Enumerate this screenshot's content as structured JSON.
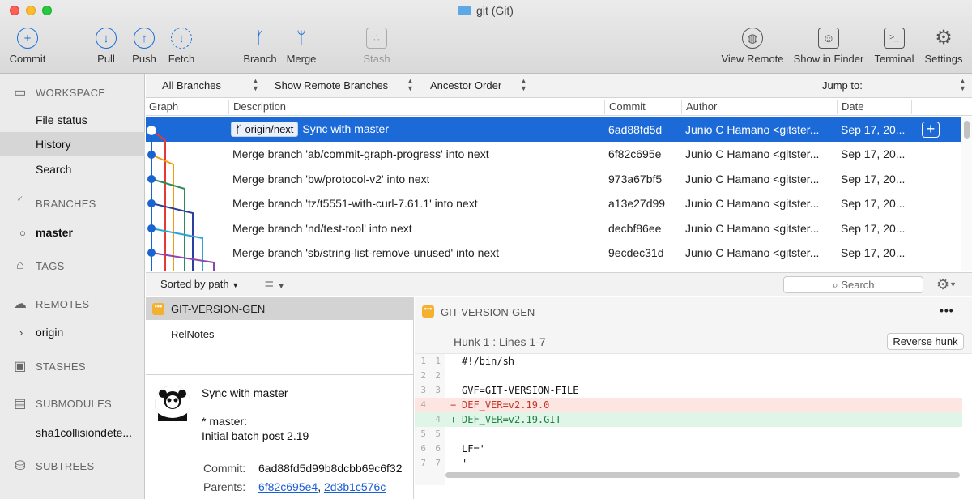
{
  "window": {
    "title": "git (Git)"
  },
  "toolbar": [
    {
      "id": "commit",
      "label": "Commit",
      "icon": "plus-circle-icon",
      "glyph": "+"
    },
    {
      "id": "pull",
      "label": "Pull",
      "icon": "arrow-down-circle-icon",
      "glyph": "↓"
    },
    {
      "id": "push",
      "label": "Push",
      "icon": "arrow-up-circle-icon",
      "glyph": "↑"
    },
    {
      "id": "fetch",
      "label": "Fetch",
      "icon": "fetch-circle-icon",
      "glyph": "↓"
    },
    {
      "id": "branch",
      "label": "Branch",
      "icon": "branch-icon",
      "glyph": "ᚶ"
    },
    {
      "id": "merge",
      "label": "Merge",
      "icon": "merge-icon",
      "glyph": "ᛘ"
    },
    {
      "id": "stash",
      "label": "Stash",
      "icon": "stash-icon",
      "glyph": "∴"
    },
    {
      "id": "view-remote",
      "label": "View Remote",
      "icon": "globe-icon",
      "glyph": "🌐"
    },
    {
      "id": "show-in-finder",
      "label": "Show in Finder",
      "icon": "finder-icon",
      "glyph": "☺"
    },
    {
      "id": "terminal",
      "label": "Terminal",
      "icon": "terminal-icon",
      "glyph": ">_"
    },
    {
      "id": "settings",
      "label": "Settings",
      "icon": "gear-icon",
      "glyph": "⚙"
    }
  ],
  "sidebar": {
    "workspace": {
      "label": "WORKSPACE",
      "items": [
        "File status",
        "History",
        "Search"
      ],
      "selected": "History"
    },
    "branches": {
      "label": "BRANCHES",
      "items": [
        "master"
      ]
    },
    "tags": {
      "label": "TAGS"
    },
    "remotes": {
      "label": "REMOTES",
      "items": [
        "origin"
      ]
    },
    "stashes": {
      "label": "STASHES"
    },
    "submodules": {
      "label": "SUBMODULES",
      "items": [
        "sha1collisiondete..."
      ]
    },
    "subtrees": {
      "label": "SUBTREES"
    }
  },
  "filters": {
    "branches": "All Branches",
    "remote": "Show Remote Branches",
    "order": "Ancestor Order",
    "jump": "Jump to:"
  },
  "columns": {
    "graph": "Graph",
    "description": "Description",
    "commit": "Commit",
    "author": "Author",
    "date": "Date"
  },
  "commits": [
    {
      "tag": "origin/next",
      "description": "Sync with master",
      "hash": "6ad88fd5d",
      "author": "Junio C Hamano <gitster...",
      "date": "Sep 17, 20..."
    },
    {
      "tag": "",
      "description": "Merge branch 'ab/commit-graph-progress' into next",
      "hash": "6f82c695e",
      "author": "Junio C Hamano <gitster...",
      "date": "Sep 17, 20..."
    },
    {
      "tag": "",
      "description": "Merge branch 'bw/protocol-v2' into next",
      "hash": "973a67bf5",
      "author": "Junio C Hamano <gitster...",
      "date": "Sep 17, 20..."
    },
    {
      "tag": "",
      "description": "Merge branch 'tz/t5551-with-curl-7.61.1' into next",
      "hash": "a13e27d99",
      "author": "Junio C Hamano <gitster...",
      "date": "Sep 17, 20..."
    },
    {
      "tag": "",
      "description": "Merge branch 'nd/test-tool' into next",
      "hash": "decbf86ee",
      "author": "Junio C Hamano <gitster...",
      "date": "Sep 17, 20..."
    },
    {
      "tag": "",
      "description": "Merge branch 'sb/string-list-remove-unused' into next",
      "hash": "9ecdec31d",
      "author": "Junio C Hamano <gitster...",
      "date": "Sep 17, 20..."
    }
  ],
  "files": {
    "sort": "Sorted by path",
    "search_placeholder": "Search",
    "items": [
      {
        "name": "GIT-VERSION-GEN",
        "selected": true
      },
      {
        "name": "RelNotes",
        "selected": false
      }
    ]
  },
  "detail": {
    "subject": "Sync with master",
    "body1": "* master:",
    "body2": "Initial batch post 2.19",
    "commit_label": "Commit:",
    "commit_value": "6ad88fd5d99b8dcbb69c6f32",
    "parents_label": "Parents:",
    "parents": [
      "6f82c695e4",
      "2d3b1c576c"
    ],
    "parents_sep": ","
  },
  "diff": {
    "file": "GIT-VERSION-GEN",
    "more": "•••",
    "hunk": "Hunk 1 : Lines 1-7",
    "reverse": "Reverse hunk",
    "lines": [
      {
        "old": "1",
        "new": "1",
        "type": "ctx",
        "sign": "",
        "text": "#!/bin/sh"
      },
      {
        "old": "2",
        "new": "2",
        "type": "ctx",
        "sign": "",
        "text": ""
      },
      {
        "old": "3",
        "new": "3",
        "type": "ctx",
        "sign": "",
        "text": "GVF=GIT-VERSION-FILE"
      },
      {
        "old": "4",
        "new": "",
        "type": "del",
        "sign": "−",
        "text": "DEF_VER=v2.19.0"
      },
      {
        "old": "",
        "new": "4",
        "type": "add",
        "sign": "+",
        "text": "DEF_VER=v2.19.GIT"
      },
      {
        "old": "5",
        "new": "5",
        "type": "ctx",
        "sign": "",
        "text": ""
      },
      {
        "old": "6",
        "new": "6",
        "type": "ctx",
        "sign": "",
        "text": "LF='"
      },
      {
        "old": "7",
        "new": "7",
        "type": "ctx",
        "sign": "",
        "text": "'"
      }
    ]
  },
  "colors": {
    "accent": "#1b6ad8",
    "file_icon": "#f5b030"
  }
}
